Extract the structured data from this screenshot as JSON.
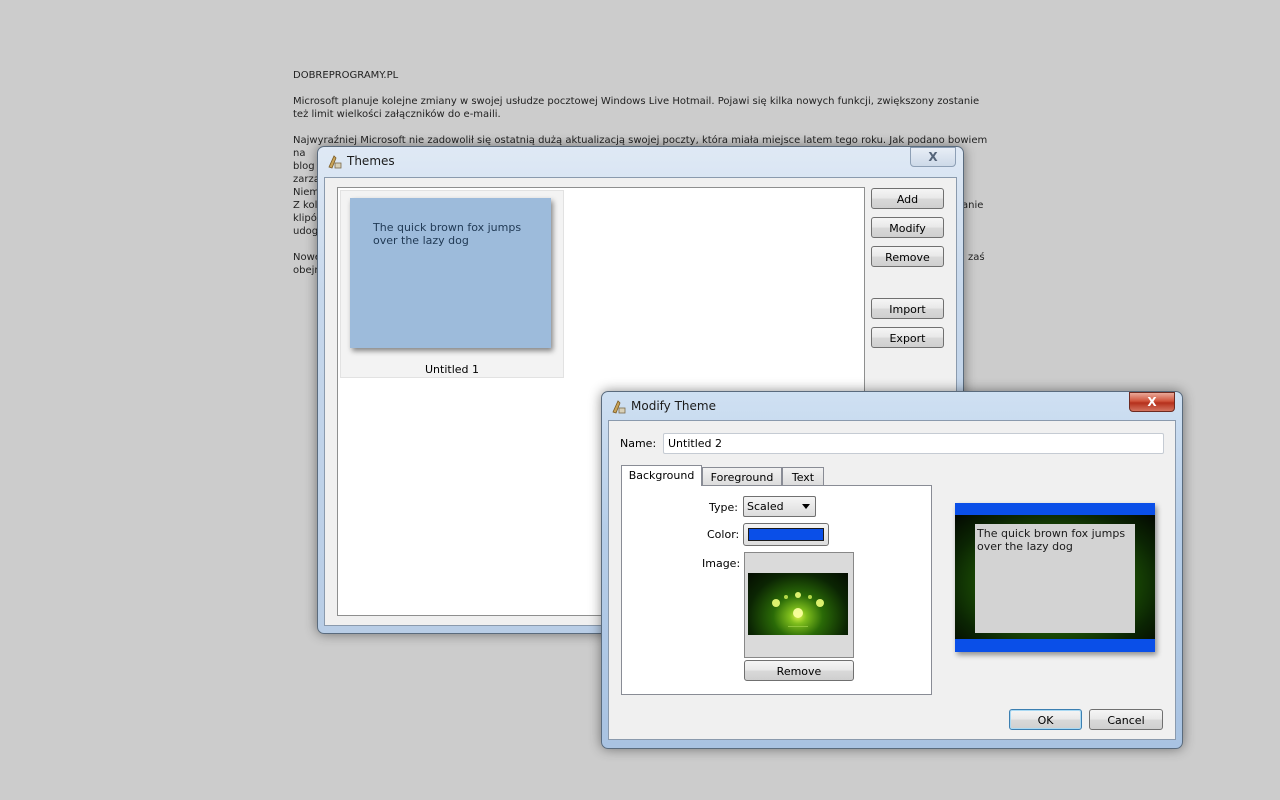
{
  "document": {
    "site": "DOBREPROGRAMY.PL",
    "para1": "Microsoft planuje kolejne zmiany w swojej usłudze pocztowej Windows Live Hotmail. Pojawi się kilka nowych funkcji, zwiększony zostanie też limit wielkości załączników do e-maili.",
    "para2_line1": "Najwyraźniej Microsoft nie zadowolił się ostatnią dużą aktualizacją swojej poczty, która miała miejsce latem tego roku. Jak podano bowiem na",
    "para2_frags": [
      "blog",
      "zarzą",
      "Niem"
    ],
    "para3_frags": [
      "Z kol",
      "klipó",
      "udog"
    ],
    "para3_tail": "anie",
    "para4_frags": [
      "Nowe",
      "obejr"
    ],
    "para4_tail": "j zaś"
  },
  "themes_window": {
    "title": "Themes",
    "close_label": "X",
    "theme_items": [
      {
        "preview_text": "The quick brown fox jumps over the lazy dog",
        "name": "Untitled 1"
      }
    ],
    "buttons": {
      "add": "Add",
      "modify": "Modify",
      "remove": "Remove",
      "import": "Import",
      "export": "Export"
    },
    "colors": {
      "preview_bg": "#9dbbdb"
    }
  },
  "modify_window": {
    "title": "Modify Theme",
    "close_label": "X",
    "name_label": "Name:",
    "name_value": "Untitled 2",
    "tabs": [
      {
        "label": "Background",
        "active": true
      },
      {
        "label": "Foreground",
        "active": false
      },
      {
        "label": "Text",
        "active": false
      }
    ],
    "type_label": "Type:",
    "type_value": "Scaled",
    "color_label": "Color:",
    "color_value": "#0a4fe8",
    "image_label": "Image:",
    "image_remove_label": "Remove",
    "preview_text": "The quick brown fox jumps over the lazy dog",
    "ok_label": "OK",
    "cancel_label": "Cancel"
  }
}
